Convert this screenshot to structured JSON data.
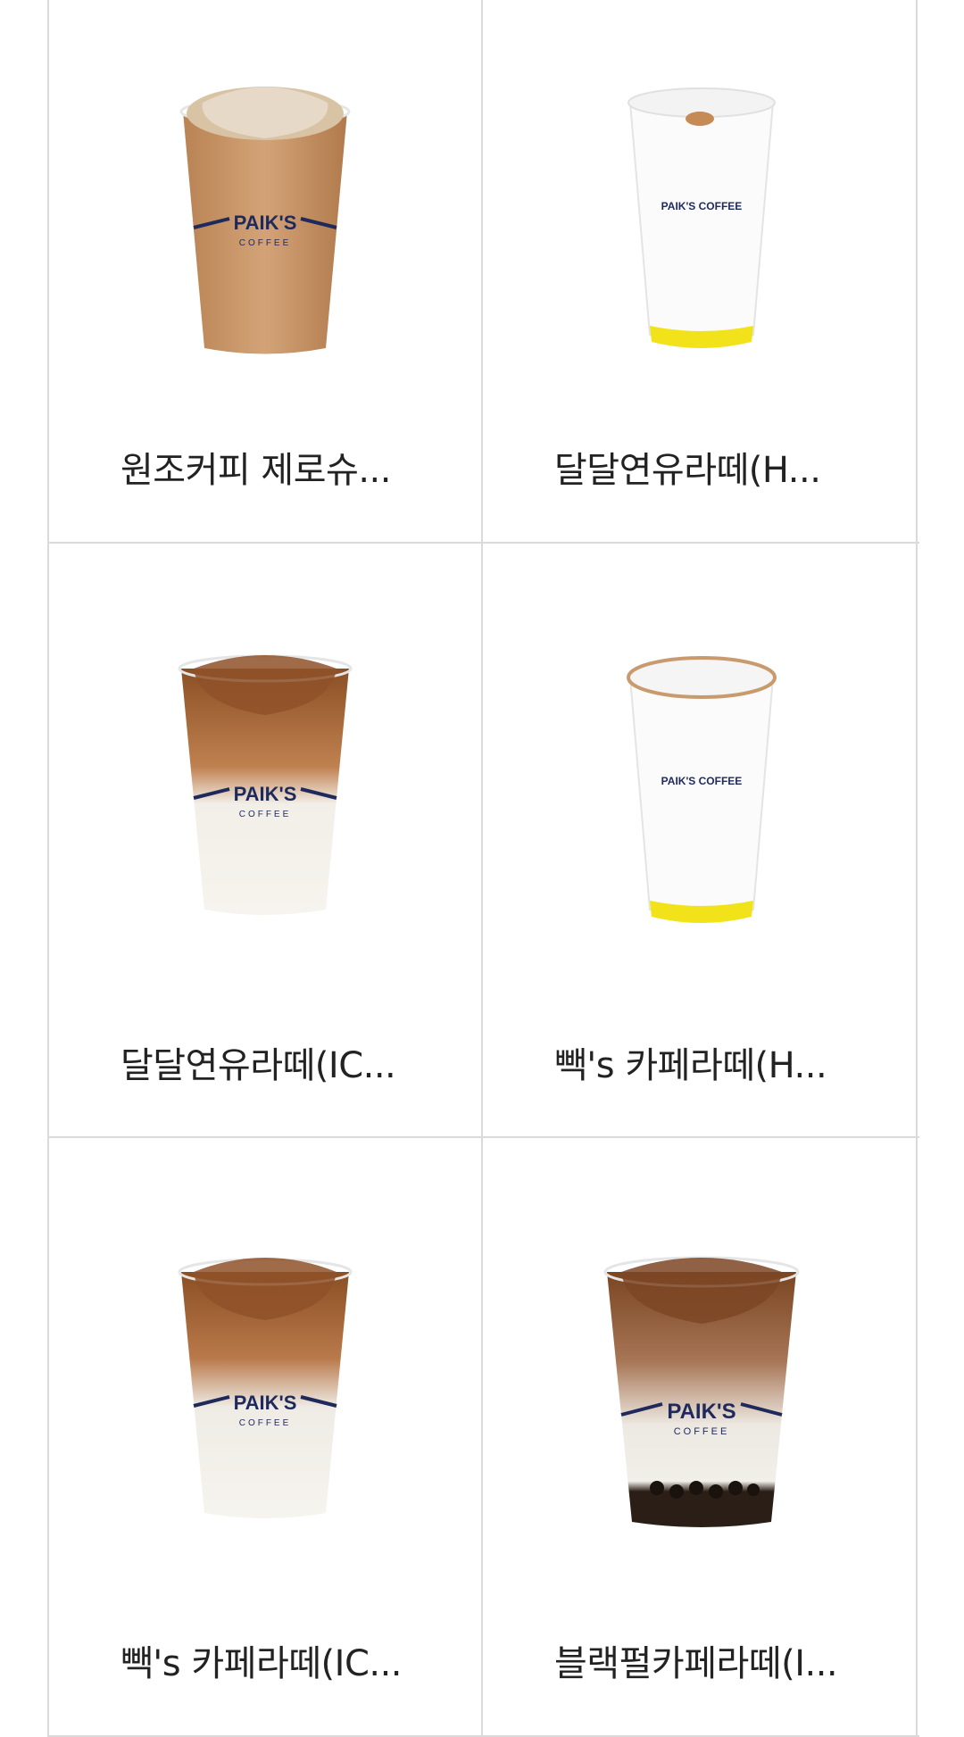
{
  "products": [
    {
      "name": "원조커피 제로슈...",
      "drink": "iced-light",
      "cup": "clear",
      "brand": "PAIK'S",
      "brand_sub": "COFFEE"
    },
    {
      "name": "달달연유라떼(H...",
      "drink": "hot",
      "cup": "paper",
      "brand": "PAIK'S COFFEE",
      "brand_sub": ""
    },
    {
      "name": "달달연유라떼(IC...",
      "drink": "iced-layer",
      "cup": "clear",
      "brand": "PAIK'S",
      "brand_sub": "COFFEE"
    },
    {
      "name": "빽's 카페라떼(H...",
      "drink": "hot",
      "cup": "paper",
      "brand": "PAIK'S COFFEE",
      "brand_sub": ""
    },
    {
      "name": "빽's 카페라떼(IC...",
      "drink": "iced-layer",
      "cup": "clear",
      "brand": "PAIK'S",
      "brand_sub": "COFFEE"
    },
    {
      "name": "블랙펄카페라떼(I...",
      "drink": "iced-pearl",
      "cup": "clear",
      "brand": "PAIK'S",
      "brand_sub": "COFFEE"
    }
  ],
  "colors": {
    "brand_navy": "#1f2a5c",
    "paper_yellow": "#f2e21a",
    "grid_line": "#dadada"
  }
}
